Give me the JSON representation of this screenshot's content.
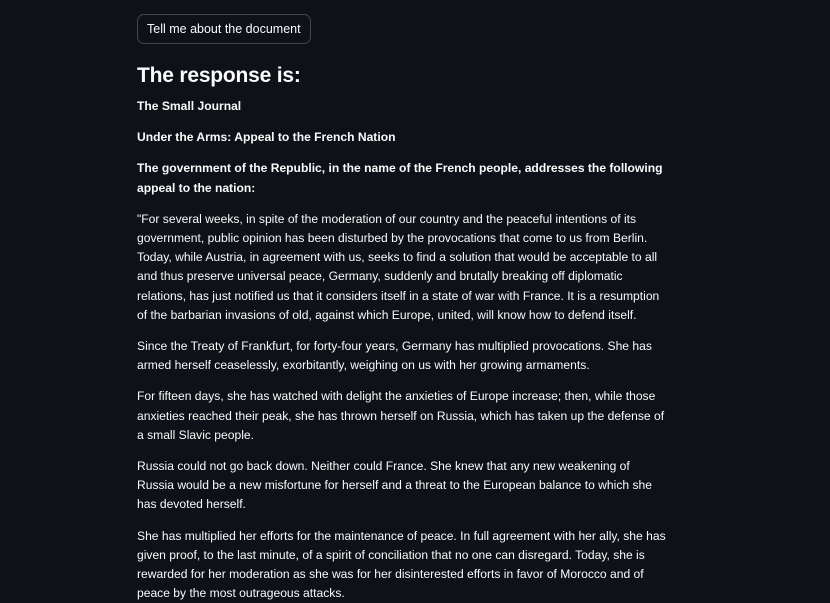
{
  "button": {
    "label": "Tell me about the document"
  },
  "response": {
    "heading": "The response is:",
    "bold_lines": [
      "The Small Journal",
      "Under the Arms: Appeal to the French Nation",
      "The government of the Republic, in the name of the French people, addresses the following appeal to the nation:"
    ],
    "paragraphs": [
      "\"For several weeks, in spite of the moderation of our country and the peaceful intentions of its government, public opinion has been disturbed by the provocations that come to us from Berlin. Today, while Austria, in agreement with us, seeks to find a solution that would be acceptable to all and thus preserve universal peace, Germany, suddenly and brutally breaking off diplomatic relations, has just notified us that it considers itself in a state of war with France. It is a resumption of the barbarian invasions of old, against which Europe, united, will know how to defend itself.",
      "Since the Treaty of Frankfurt, for forty-four years, Germany has multiplied provocations. She has armed herself ceaselessly, exorbitantly, weighing on us with her growing armaments.",
      "For fifteen days, she has watched with delight the anxieties of Europe increase; then, while those anxieties reached their peak, she has thrown herself on Russia, which has taken up the defense of a small Slavic people.",
      "Russia could not go back down. Neither could France. She knew that any new weakening of Russia would be a new misfortune for herself and a threat to the European balance to which she has devoted herself.",
      "She has multiplied her efforts for the maintenance of peace. In full agreement with her ally, she has given proof, to the last minute, of a spirit of conciliation that no one can disregard. Today, she is rewarded for her moderation as she was for her disinterested efforts in favor of Morocco and of peace by the most outrageous attacks."
    ]
  },
  "colors": {
    "background": "#0e1117",
    "text": "#fafafa",
    "button_border": "rgba(250,250,250,0.22)"
  }
}
